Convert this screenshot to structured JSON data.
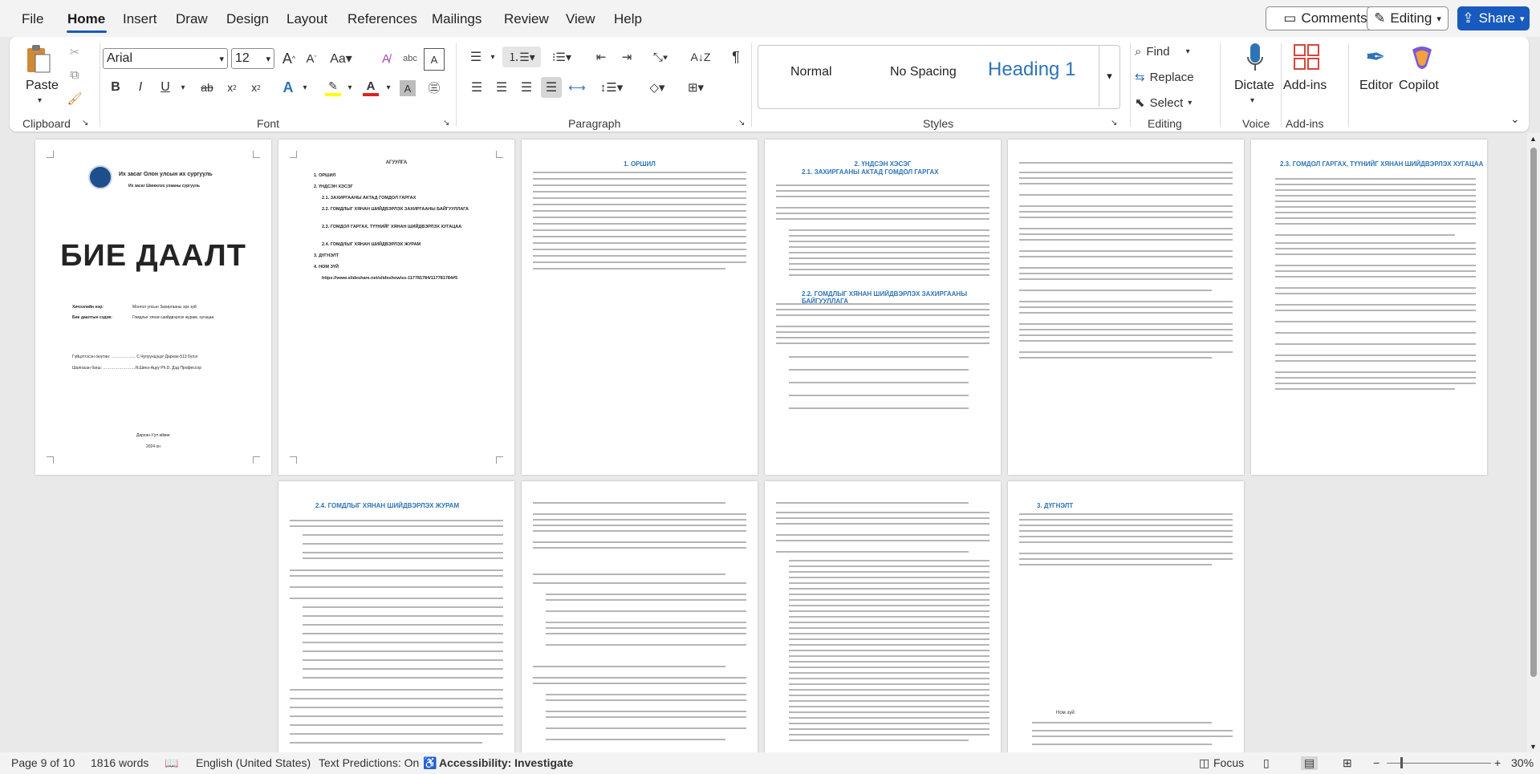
{
  "menu": {
    "items": [
      "File",
      "Home",
      "Insert",
      "Draw",
      "Design",
      "Layout",
      "References",
      "Mailings",
      "Review",
      "View",
      "Help"
    ],
    "comments_label": "Comments",
    "editing_label": "Editing",
    "share_label": "Share"
  },
  "ribbon": {
    "font_name": "Arial",
    "font_size": "12",
    "paste_label": "Paste",
    "groups": {
      "clipboard": "Clipboard",
      "font": "Font",
      "paragraph": "Paragraph",
      "styles": "Styles",
      "editing": "Editing",
      "voice": "Voice",
      "addins": "Add-ins"
    },
    "styles": {
      "normal": "Normal",
      "no_spacing": "No Spacing",
      "heading1": "Heading 1"
    },
    "editing": {
      "find": "Find",
      "replace": "Replace",
      "select": "Select"
    },
    "dictate_label": "Dictate",
    "addins_label": "Add-ins",
    "editor_label": "Editor",
    "copilot_label": "Copilot",
    "colors": {
      "accent": "#185abd",
      "highlight": "#ffff00",
      "font_color": "#e02020"
    }
  },
  "document": {
    "cover": {
      "university": "Их засаг Олон улсын их сургууль",
      "school": "Их засаг Шинжлэх ухааны сургууль",
      "title": "БИЕ ДААЛТ",
      "subject_label": "Хичээлийн нэр:",
      "subject_value": "Монгол улсын Захиргааны эрх зүй",
      "topic_label": "Бие даалтын сэдэв:",
      "topic_value": "Гомдлыг хянан шийдвэрлэх журам, хугацаа",
      "student": "Гүйцэтгэсэн оюутан: ……………… С.Чулуунцэцэг Дархан-513 бүлэг",
      "teacher": "Шалгасан багш: ……………………Я.Шинэ-Ацуу Ph.D, Дэд Профессор",
      "city": "Дархан-Уул аймаг",
      "year": "2024 он"
    },
    "toc": {
      "title": "АГУУЛГА",
      "items": [
        "1. ОРШИЛ",
        "2. ҮНДСЭН ХЭСЭГ",
        "2.1. ЗАХИРГААНЫ АКТАД ГОМДОЛ ГАРГАХ",
        "2.2. ГОМДЛЫГ ХЯНАН ШИЙДВЭРЛЭХ ЗАХИРГААНЫ БАЙГУУЛЛАГА",
        "2.3. ГОМДОЛ ГАРГАХ, ТҮҮНИЙГ ХЯНАН ШИЙДВЭРЛЭХ ХУГАЦАА",
        "2.4. ГОМДЛЫГ ХЯНАН ШИЙДВЭРЛЭХ ЖУРАМ",
        "3. ДҮГНЭЛТ",
        "4. НОМ ЗҮЙ",
        "https://www.slideshare.net/slideshow/ss-117781784/117781784#5"
      ]
    },
    "headings": {
      "p3": "1. ОРШИЛ",
      "p4": "2. ҮНДСЭН ХЭСЭГ",
      "p4_sub": "2.1. ЗАХИРГААНЫ АКТАД ГОМДОЛ ГАРГАХ",
      "p4_sub2": "2.2. ГОМДЛЫГ ХЯНАН ШИЙДВЭРЛЭХ ЗАХИРГААНЫ БАЙГУУЛЛАГА",
      "p6": "2.3. ГОМДОЛ ГАРГАХ, ТҮҮНИЙГ ХЯНАН ШИЙДВЭРЛЭХ ХУГАЦАА",
      "p7": "2.4. ГОМДЛЫГ ХЯНАН ШИЙДВЭРЛЭХ ЖУРАМ",
      "p10": "3. ДҮГНЭЛТ",
      "p10_refs": "Ном зүй:"
    }
  },
  "status": {
    "page": "Page 9 of 10",
    "words": "1816 words",
    "language": "English (United States)",
    "predictions": "Text Predictions: On",
    "accessibility": "Accessibility: Investigate",
    "focus": "Focus",
    "zoom": "30%"
  }
}
